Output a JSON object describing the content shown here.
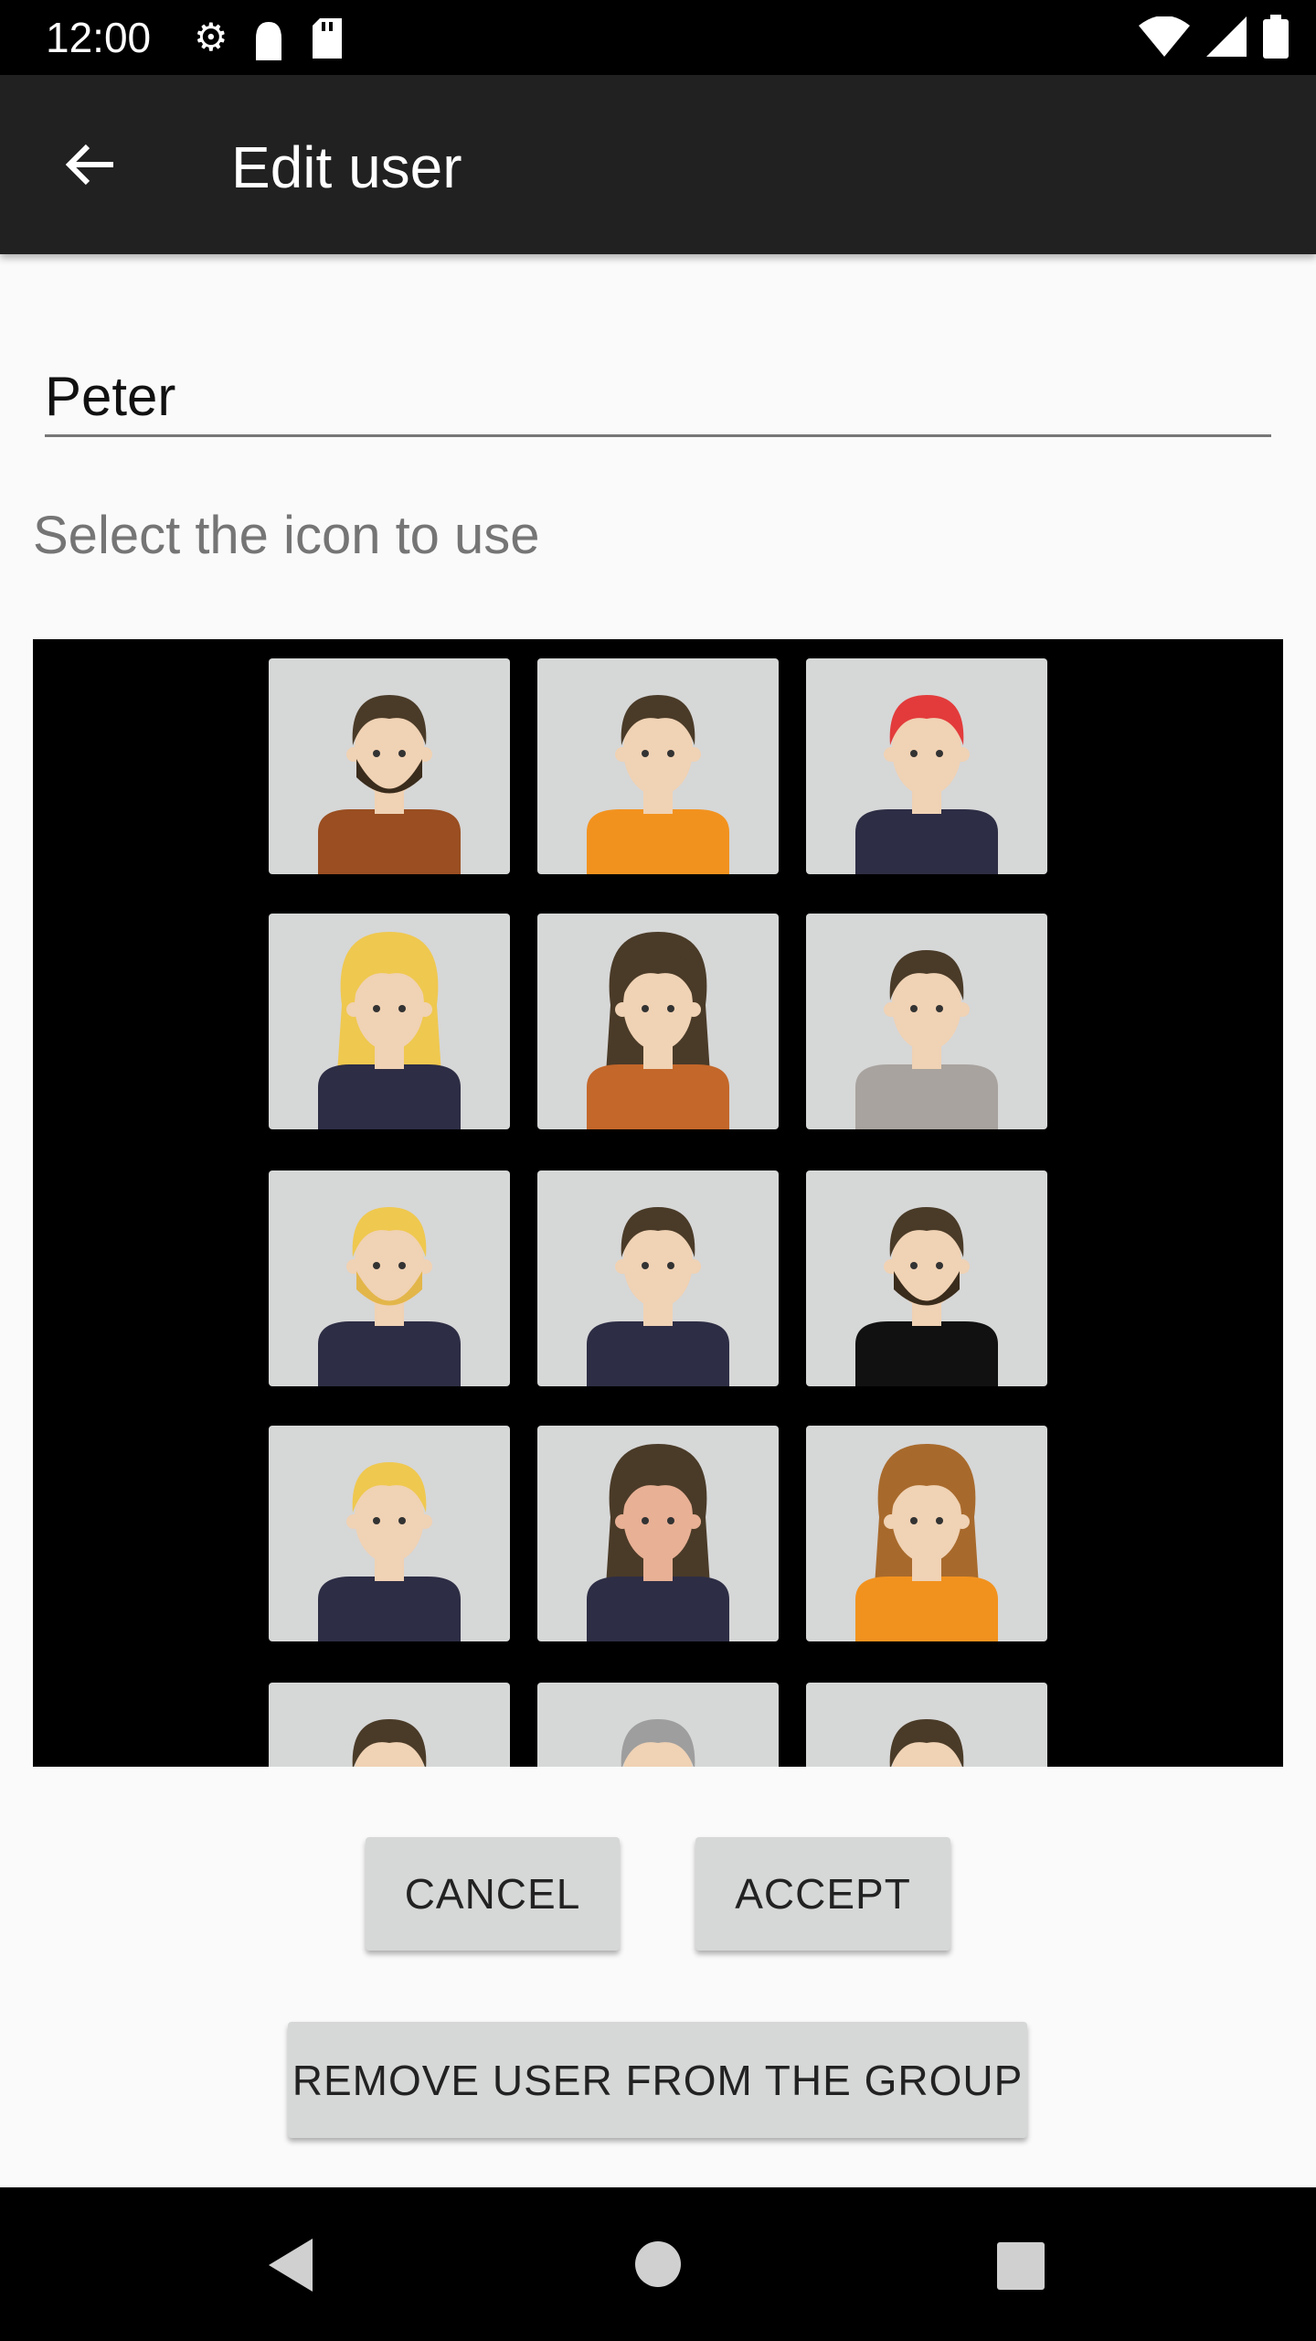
{
  "status_bar": {
    "time": "12:00",
    "icons": [
      "gear-icon",
      "notification-icon",
      "sd-card-icon",
      "wifi-icon",
      "signal-icon",
      "battery-icon"
    ]
  },
  "app_bar": {
    "title": "Edit user",
    "back_icon": "arrow-left-icon"
  },
  "name_field": {
    "value": "Peter"
  },
  "icon_label": "Select the icon to use",
  "avatars": [
    {
      "hair": "#4a3b28",
      "skin": "#f0d2b4",
      "shirt": "#9a4e21",
      "beard": "#3a2c1c"
    },
    {
      "hair": "#4a3b28",
      "skin": "#f0d2b4",
      "shirt": "#f2921e"
    },
    {
      "hair": "#e33b3b",
      "skin": "#f0d2b4",
      "shirt": "#2d2d45"
    },
    {
      "hair": "#efc84f",
      "skin": "#f0d2b4",
      "shirt": "#2d2d45",
      "long": true
    },
    {
      "hair": "#4a3b28",
      "skin": "#f0d2b4",
      "shirt": "#c4672a",
      "long": true
    },
    {
      "hair": "#4a3b28",
      "skin": "#f0d2b4",
      "shirt": "#a8a39e"
    },
    {
      "hair": "#efc84f",
      "skin": "#f0d2b4",
      "shirt": "#2d2d45",
      "beard": "#e3b64a"
    },
    {
      "hair": "#4a3b28",
      "skin": "#f0d2b4",
      "shirt": "#2d2d45"
    },
    {
      "hair": "#4a3b28",
      "skin": "#f0d2b4",
      "shirt": "#111111",
      "beard": "#3a2c1c"
    },
    {
      "hair": "#efc84f",
      "skin": "#f0d2b4",
      "shirt": "#2d2d45"
    },
    {
      "hair": "#4a3b28",
      "skin": "#e8b095",
      "shirt": "#2d2d45",
      "long": true
    },
    {
      "hair": "#a86a2c",
      "skin": "#f0d2b4",
      "shirt": "#f2921e",
      "long": true
    },
    {
      "hair": "#4a3b28",
      "skin": "#f0d2b4",
      "shirt": "#2d2d45"
    },
    {
      "hair": "#9e9e9e",
      "skin": "#f0d2b4",
      "shirt": "#2d2d45"
    },
    {
      "hair": "#4a3b28",
      "skin": "#f0d2b4",
      "shirt": "#2d2d45"
    }
  ],
  "buttons": {
    "cancel": "CANCEL",
    "accept": "ACCEPT",
    "remove": "REMOVE USER FROM THE GROUP"
  },
  "nav_bar": {
    "icons": [
      "back-triangle-icon",
      "home-circle-icon",
      "recents-square-icon"
    ]
  }
}
